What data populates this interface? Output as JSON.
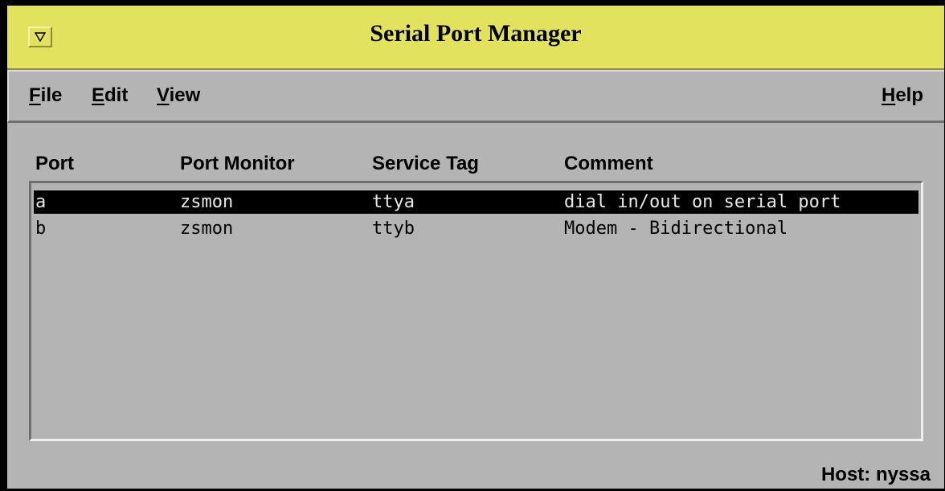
{
  "window": {
    "title": "Serial Port Manager",
    "menu_button_icon": "down-triangle-icon",
    "title_bar_color": "#e2e25e",
    "background_color": "#b4b4b4"
  },
  "menubar": {
    "file": {
      "mnemonic": "F",
      "rest": "ile"
    },
    "edit": {
      "mnemonic": "E",
      "rest": "dit"
    },
    "view": {
      "mnemonic": "V",
      "rest": "iew"
    },
    "help": {
      "mnemonic": "H",
      "rest": "elp"
    }
  },
  "table": {
    "headers": [
      "Port",
      "Port Monitor",
      "Service Tag",
      "Comment"
    ],
    "rows": [
      {
        "port": "a",
        "monitor": "zsmon",
        "tag": "ttya",
        "comment": "dial in/out on serial port",
        "selected": true
      },
      {
        "port": "b",
        "monitor": "zsmon",
        "tag": "ttyb",
        "comment": "Modem - Bidirectional",
        "selected": false
      }
    ]
  },
  "status": {
    "host": "Host: nyssa"
  }
}
